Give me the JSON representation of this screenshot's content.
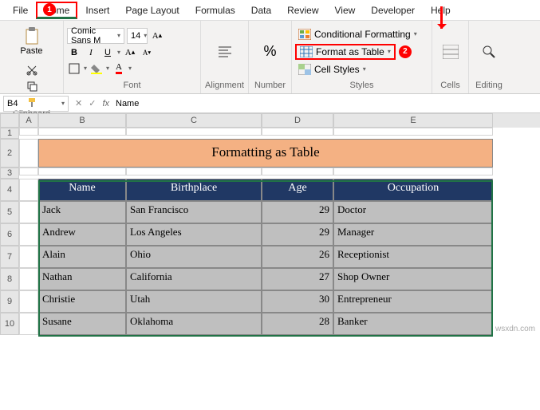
{
  "tabs": [
    "File",
    "Home",
    "Insert",
    "Page Layout",
    "Formulas",
    "Data",
    "Review",
    "View",
    "Developer",
    "Help"
  ],
  "active_tab": "Home",
  "ribbon": {
    "groups": [
      "Clipboard",
      "Font",
      "Alignment",
      "Number",
      "Styles",
      "Cells",
      "Editing"
    ],
    "clipboard": {
      "paste": "Paste"
    },
    "font": {
      "name": "Comic Sans M",
      "size": "14"
    },
    "styles": {
      "conditional": "Conditional Formatting",
      "format_table": "Format as Table",
      "cell_styles": "Cell Styles"
    },
    "cells": "Cells",
    "editing": "Editing"
  },
  "name_box": "B4",
  "formula_bar": "Name",
  "columns": [
    "A",
    "B",
    "C",
    "D",
    "E"
  ],
  "title_cell": "Formatting as Table",
  "headers": [
    "Name",
    "Birthplace",
    "Age",
    "Occupation"
  ],
  "rows": [
    {
      "n": "5",
      "name": "Jack",
      "birthplace": "San Francisco",
      "age": "29",
      "occ": "Doctor"
    },
    {
      "n": "6",
      "name": "Andrew",
      "birthplace": "Los Angeles",
      "age": "29",
      "occ": "Manager"
    },
    {
      "n": "7",
      "name": "Alain",
      "birthplace": "Ohio",
      "age": "26",
      "occ": "Receptionist"
    },
    {
      "n": "8",
      "name": "Nathan",
      "birthplace": "California",
      "age": "27",
      "occ": "Shop Owner"
    },
    {
      "n": "9",
      "name": "Christie",
      "birthplace": "Utah",
      "age": "30",
      "occ": "Entrepreneur"
    },
    {
      "n": "10",
      "name": "Susane",
      "birthplace": "Oklahoma",
      "age": "28",
      "occ": "Banker"
    }
  ],
  "row_spacers": [
    "1",
    "3"
  ],
  "title_row": "2",
  "header_row": "4",
  "watermark": "wsxdn.com",
  "chart_data": {
    "type": "table",
    "title": "Formatting as Table",
    "columns": [
      "Name",
      "Birthplace",
      "Age",
      "Occupation"
    ],
    "data": [
      [
        "Jack",
        "San Francisco",
        29,
        "Doctor"
      ],
      [
        "Andrew",
        "Los Angeles",
        29,
        "Manager"
      ],
      [
        "Alain",
        "Ohio",
        26,
        "Receptionist"
      ],
      [
        "Nathan",
        "California",
        27,
        "Shop Owner"
      ],
      [
        "Christie",
        "Utah",
        30,
        "Entrepreneur"
      ],
      [
        "Susane",
        "Oklahoma",
        28,
        "Banker"
      ]
    ]
  }
}
